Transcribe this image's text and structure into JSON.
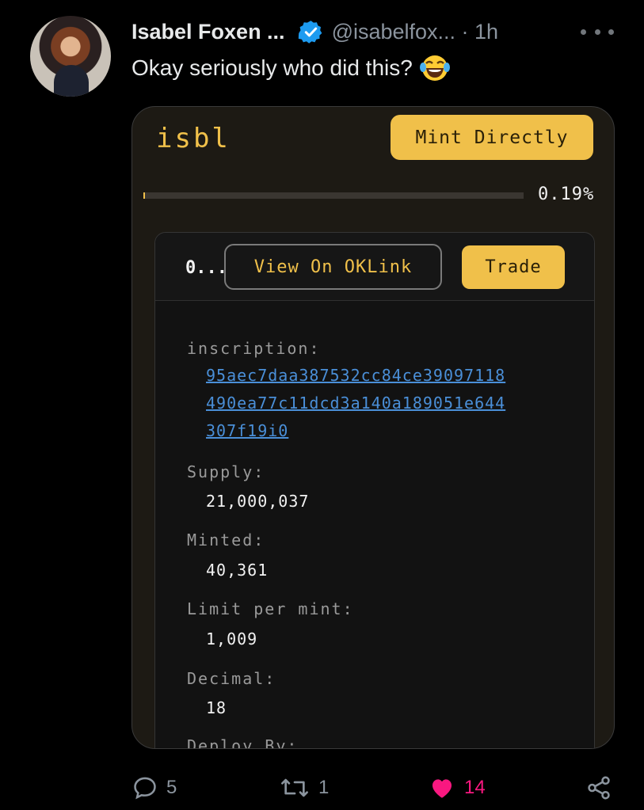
{
  "tweet": {
    "author_name": "Isabel Foxen ...",
    "handle_time": "@isabelfox... · 1h",
    "text": "Okay seriously who did this?"
  },
  "card": {
    "title": "isbl",
    "mint_button": "Mint Directly",
    "progress_percent": 0.19,
    "progress_label": "0.19%",
    "truncated_label": "0...",
    "oklink_button": "View On OKLink",
    "trade_button": "Trade",
    "fields": {
      "inscription_label": "inscription:",
      "inscription_line1": "95aec7daa387532cc84ce39097118",
      "inscription_line2": "490ea77c11dcd3a140a189051e644",
      "inscription_line3": "307f19i0",
      "supply_label": "Supply:",
      "supply_value": "21,000,037",
      "minted_label": "Minted:",
      "minted_value": "40,361",
      "limit_label": "Limit per mint:",
      "limit_value": "1,009",
      "decimal_label": "Decimal:",
      "decimal_value": "18",
      "deploy_label": "Deploy By:"
    }
  },
  "actions": {
    "replies": "5",
    "reposts": "1",
    "likes": "14"
  },
  "colors": {
    "accent": "#f0c04a",
    "like": "#f91880",
    "link": "#4a8fd8",
    "verified": "#1d9bf0"
  },
  "icons": [
    "verified-badge-icon",
    "more-icon",
    "reply-icon",
    "repost-icon",
    "like-icon",
    "share-icon",
    "laughing-emoji-icon"
  ]
}
